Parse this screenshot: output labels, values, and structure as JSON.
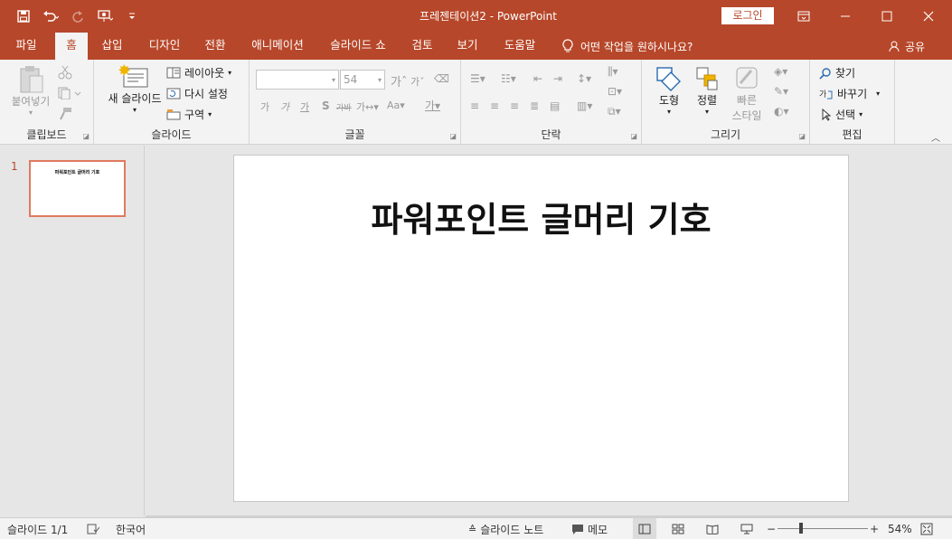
{
  "window": {
    "title": "프레젠테이션2  -  PowerPoint",
    "login_label": "로그인"
  },
  "tabs": [
    {
      "label": "파일"
    },
    {
      "label": "홈"
    },
    {
      "label": "삽입"
    },
    {
      "label": "디자인"
    },
    {
      "label": "전환"
    },
    {
      "label": "애니메이션"
    },
    {
      "label": "슬라이드 쇼"
    },
    {
      "label": "검토"
    },
    {
      "label": "보기"
    },
    {
      "label": "도움말"
    }
  ],
  "active_tab": "홈",
  "tell_me": "어떤 작업을 원하시나요?",
  "share_label": "공유",
  "ribbon": {
    "clipboard": {
      "label": "클립보드",
      "paste": "붙여넣기"
    },
    "slides": {
      "label": "슬라이드",
      "new_slide": "새 슬라이드",
      "layout": "레이아웃",
      "reset": "다시 설정",
      "section": "구역"
    },
    "font": {
      "label": "글꼴",
      "font_name": "",
      "font_size": "54"
    },
    "paragraph": {
      "label": "단락"
    },
    "drawing": {
      "label": "그리기",
      "shapes": "도형",
      "arrange": "정렬",
      "quick_styles_1": "빠른",
      "quick_styles_2": "스타일"
    },
    "editing": {
      "label": "편집",
      "find": "찾기",
      "replace": "바꾸기",
      "select": "선택"
    }
  },
  "thumbnails": [
    {
      "number": "1",
      "title": "파워포인트 글머리 기호"
    }
  ],
  "slide": {
    "title": "파워포인트 글머리 기호"
  },
  "status": {
    "slide_count": "슬라이드 1/1",
    "language": "한국어",
    "notes": "슬라이드 노트",
    "comments": "메모",
    "zoom": "54%"
  },
  "colors": {
    "accent": "#b7472a",
    "ribbon_bg": "#f3f3f3",
    "workspace_bg": "#e6e6e6"
  }
}
